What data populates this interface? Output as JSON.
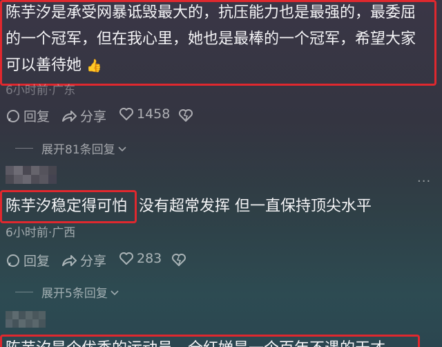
{
  "comment1": {
    "lines": [
      "陈芋汐是承受网暴诋毁最大的，抗压能力也是最强的，最委屈",
      "的一个冠军，但在我心里，她也是最棒的一个冠军，希望大家",
      "可以善待她"
    ],
    "emoji": "👍",
    "meta": "6小时前·广东",
    "reply_label": "回复",
    "share_label": "分享",
    "like_count": "1458",
    "expand_label": "展开81条回复"
  },
  "comment2": {
    "highlight": "陈芋汐稳定得可怕",
    "rest": "没有超常发挥 但一直保持顶尖水平",
    "meta": "6小时前·广西",
    "reply_label": "回复",
    "share_label": "分享",
    "like_count": "283",
    "expand_label": "展开5条回复"
  },
  "comment3": {
    "partial_text": "陈芋汐是个优秀的运动员，全红婵是一个百年不遇的天才"
  },
  "more_label": "···",
  "colors": {
    "highlight_border": "#e0282e",
    "background": "#343541"
  },
  "icons": [
    "reply-icon",
    "share-icon",
    "heart-icon",
    "dislike-heart-icon",
    "chevron-down-icon",
    "thumbs-up-emoji"
  ]
}
